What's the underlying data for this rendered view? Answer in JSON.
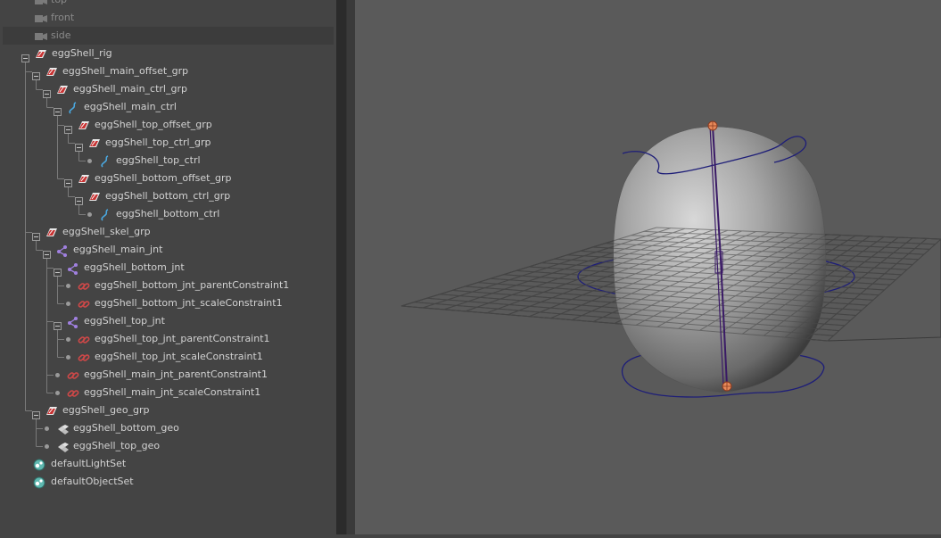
{
  "outliner": {
    "cameras": [
      {
        "label": "top",
        "icon": "camera-icon"
      },
      {
        "label": "front",
        "icon": "camera-icon"
      },
      {
        "label": "side",
        "icon": "camera-icon"
      }
    ],
    "nodes": [
      {
        "label": "eggShell_rig",
        "icon": "group-icon",
        "depth": 0,
        "expander": "collapse"
      },
      {
        "label": "eggShell_main_offset_grp",
        "icon": "group-icon",
        "depth": 1,
        "expander": "collapse"
      },
      {
        "label": "eggShell_main_ctrl_grp",
        "icon": "group-icon",
        "depth": 2,
        "expander": "collapse"
      },
      {
        "label": "eggShell_main_ctrl",
        "icon": "curve-icon",
        "depth": 3,
        "expander": "collapse"
      },
      {
        "label": "eggShell_top_offset_grp",
        "icon": "group-icon",
        "depth": 4,
        "expander": "collapse"
      },
      {
        "label": "eggShell_top_ctrl_grp",
        "icon": "group-icon",
        "depth": 5,
        "expander": "collapse"
      },
      {
        "label": "eggShell_top_ctrl",
        "icon": "curve-icon",
        "depth": 6,
        "expander": "leaf"
      },
      {
        "label": "eggShell_bottom_offset_grp",
        "icon": "group-icon",
        "depth": 4,
        "expander": "collapse"
      },
      {
        "label": "eggShell_bottom_ctrl_grp",
        "icon": "group-icon",
        "depth": 5,
        "expander": "collapse"
      },
      {
        "label": "eggShell_bottom_ctrl",
        "icon": "curve-icon",
        "depth": 6,
        "expander": "leaf"
      },
      {
        "label": "eggShell_skel_grp",
        "icon": "group-icon",
        "depth": 1,
        "expander": "collapse"
      },
      {
        "label": "eggShell_main_jnt",
        "icon": "joint-icon",
        "depth": 2,
        "expander": "collapse"
      },
      {
        "label": "eggShell_bottom_jnt",
        "icon": "joint-icon",
        "depth": 3,
        "expander": "collapse"
      },
      {
        "label": "eggShell_bottom_jnt_parentConstraint1",
        "icon": "constraint-icon",
        "depth": 4,
        "expander": "leaf"
      },
      {
        "label": "eggShell_bottom_jnt_scaleConstraint1",
        "icon": "constraint-icon",
        "depth": 4,
        "expander": "leaf"
      },
      {
        "label": "eggShell_top_jnt",
        "icon": "joint-icon",
        "depth": 3,
        "expander": "collapse"
      },
      {
        "label": "eggShell_top_jnt_parentConstraint1",
        "icon": "constraint-icon",
        "depth": 4,
        "expander": "leaf"
      },
      {
        "label": "eggShell_top_jnt_scaleConstraint1",
        "icon": "constraint-icon",
        "depth": 4,
        "expander": "leaf"
      },
      {
        "label": "eggShell_main_jnt_parentConstraint1",
        "icon": "constraint-icon",
        "depth": 3,
        "expander": "leaf"
      },
      {
        "label": "eggShell_main_jnt_scaleConstraint1",
        "icon": "constraint-icon",
        "depth": 3,
        "expander": "leaf"
      },
      {
        "label": "eggShell_geo_grp",
        "icon": "group-icon",
        "depth": 1,
        "expander": "collapse"
      },
      {
        "label": "eggShell_bottom_geo",
        "icon": "mesh-icon",
        "depth": 2,
        "expander": "leaf"
      },
      {
        "label": "eggShell_top_geo",
        "icon": "mesh-icon",
        "depth": 2,
        "expander": "leaf"
      },
      {
        "label": "defaultLightSet",
        "icon": "set-icon",
        "depth": 0,
        "expander": "none"
      },
      {
        "label": "defaultObjectSet",
        "icon": "set-icon",
        "depth": 0,
        "expander": "none"
      }
    ]
  },
  "colors": {
    "panel_bg": "#444444",
    "viewport_bg": "#5a5a5a",
    "text": "#d2d2d2",
    "text_dim": "#8a8a8a",
    "rig_curve": "#1e1e78",
    "joint_line": "#3a1a66",
    "group_icon_red": "#c83232",
    "curve_icon_blue": "#4aa8e0",
    "joint_icon_purple": "#a080e0",
    "constraint_icon_red": "#d04848"
  }
}
